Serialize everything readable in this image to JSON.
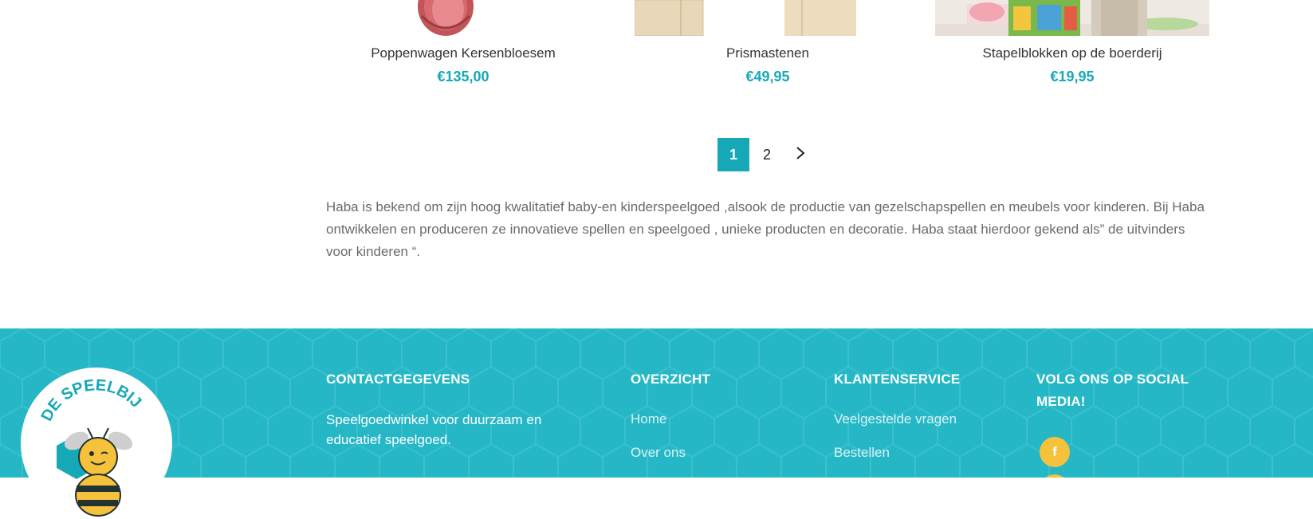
{
  "products": [
    {
      "name": "Poppenwagen Kersenbloesem",
      "price": "€135,00"
    },
    {
      "name": "Prismastenen",
      "price": "€49,95"
    },
    {
      "name": "Stapelblokken op de boerderij",
      "price": "€19,95"
    }
  ],
  "pagination": {
    "pages": [
      "1",
      "2"
    ],
    "current": "1",
    "next_icon": "chevron-right-icon"
  },
  "description": "Haba is bekend om zijn hoog kwalitatief baby-en kinderspeelgoed ,alsook de productie van gezelschapspellen en meubels voor kinderen. Bij Haba ontwikkelen en produceren ze innovatieve spellen en speelgoed , unieke producten en decoratie. Haba staat hierdoor gekend als” de uitvinders voor kinderen “.",
  "footer": {
    "logo_text": "DE SPEELBIJ",
    "contact": {
      "title": "CONTACTGEGEVENS",
      "text": "Speelgoedwinkel voor duurzaam en educatief speelgoed."
    },
    "overzicht": {
      "title": "OVERZICHT",
      "links": [
        "Home",
        "Over ons"
      ]
    },
    "klantenservice": {
      "title": "KLANTENSERVICE",
      "links": [
        "Veelgestelde vragen",
        "Bestellen"
      ]
    },
    "social": {
      "title": "VOLG ONS OP SOCIAL MEDIA!",
      "facebook_glyph": "f",
      "icons": [
        "facebook-icon",
        "instagram-icon"
      ]
    }
  },
  "colors": {
    "accent": "#17a8b8",
    "footer_bg": "#26b7c6",
    "social": "#f6c13b"
  }
}
